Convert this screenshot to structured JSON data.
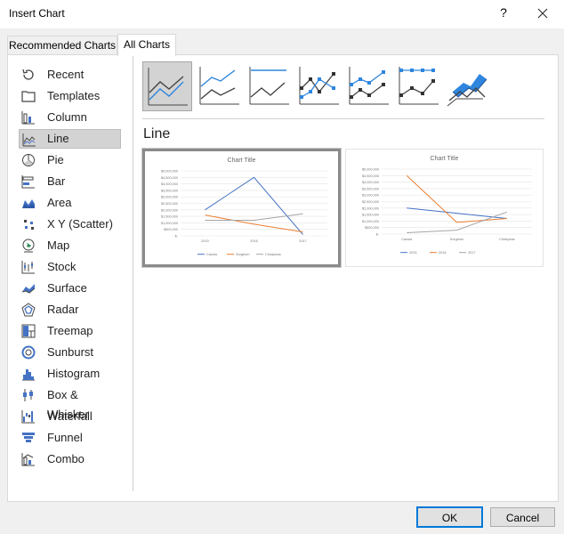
{
  "window": {
    "title": "Insert Chart",
    "help_label": "?"
  },
  "tabs": [
    {
      "label": "Recommended Charts",
      "active": false
    },
    {
      "label": "All Charts",
      "active": true
    }
  ],
  "categories": [
    {
      "label": "Recent",
      "icon": "recent-icon"
    },
    {
      "label": "Templates",
      "icon": "templates-icon"
    },
    {
      "label": "Column",
      "icon": "column-chart-icon"
    },
    {
      "label": "Line",
      "icon": "line-chart-icon",
      "selected": true
    },
    {
      "label": "Pie",
      "icon": "pie-chart-icon"
    },
    {
      "label": "Bar",
      "icon": "bar-chart-icon"
    },
    {
      "label": "Area",
      "icon": "area-chart-icon"
    },
    {
      "label": "X Y (Scatter)",
      "icon": "scatter-chart-icon"
    },
    {
      "label": "Map",
      "icon": "map-chart-icon"
    },
    {
      "label": "Stock",
      "icon": "stock-chart-icon"
    },
    {
      "label": "Surface",
      "icon": "surface-chart-icon"
    },
    {
      "label": "Radar",
      "icon": "radar-chart-icon"
    },
    {
      "label": "Treemap",
      "icon": "treemap-chart-icon"
    },
    {
      "label": "Sunburst",
      "icon": "sunburst-chart-icon"
    },
    {
      "label": "Histogram",
      "icon": "histogram-chart-icon"
    },
    {
      "label": "Box & Whisker",
      "icon": "box-whisker-chart-icon"
    },
    {
      "label": "Waterfall",
      "icon": "waterfall-chart-icon"
    },
    {
      "label": "Funnel",
      "icon": "funnel-chart-icon"
    },
    {
      "label": "Combo",
      "icon": "combo-chart-icon"
    }
  ],
  "chart_type_heading": "Line",
  "subtypes": [
    {
      "icon": "line-icon",
      "selected": true
    },
    {
      "icon": "stacked-line-icon"
    },
    {
      "icon": "100-stacked-line-icon"
    },
    {
      "icon": "line-with-markers-icon"
    },
    {
      "icon": "stacked-line-with-markers-icon"
    },
    {
      "icon": "100-stacked-line-with-markers-icon"
    },
    {
      "icon": "3d-line-icon"
    }
  ],
  "colors": {
    "blue": "#4472c4",
    "orange": "#ed7d31",
    "gray": "#a5a5a5",
    "accent": "#0078d7"
  },
  "chart_data": [
    {
      "type": "line",
      "title": "Chart Title",
      "categories": [
        "2015",
        "2016",
        "2017"
      ],
      "series": [
        {
          "name": "Canola",
          "values": [
            2000000,
            4500000,
            100000
          ]
        },
        {
          "name": "Sorghum",
          "values": [
            1600000,
            900000,
            300000
          ]
        },
        {
          "name": "Chickpeas",
          "values": [
            1200000,
            1200000,
            1700000
          ]
        }
      ],
      "y_ticks": [
        "$-",
        "$500,000",
        "$1,000,000",
        "$1,500,000",
        "$2,000,000",
        "$2,500,000",
        "$3,000,000",
        "$3,500,000",
        "$4,000,000",
        "$4,500,000",
        "$5,000,000"
      ],
      "ylim": [
        0,
        5000000
      ],
      "grid": true,
      "legend": "bottom",
      "selected": true
    },
    {
      "type": "line",
      "title": "Chart Title",
      "categories": [
        "Canola",
        "Sorghum",
        "Chickpeas"
      ],
      "series": [
        {
          "name": "2015",
          "values": [
            2000000,
            1600000,
            1200000
          ]
        },
        {
          "name": "2016",
          "values": [
            4500000,
            900000,
            1200000
          ]
        },
        {
          "name": "2017",
          "values": [
            100000,
            300000,
            1700000
          ]
        }
      ],
      "y_ticks": [
        "$-",
        "$500,000",
        "$1,000,000",
        "$1,500,000",
        "$2,000,000",
        "$2,500,000",
        "$3,000,000",
        "$3,500,000",
        "$4,000,000",
        "$4,500,000",
        "$5,000,000"
      ],
      "ylim": [
        0,
        5000000
      ],
      "grid": true,
      "legend": "bottom",
      "selected": false
    }
  ],
  "buttons": {
    "ok": "OK",
    "cancel": "Cancel"
  }
}
